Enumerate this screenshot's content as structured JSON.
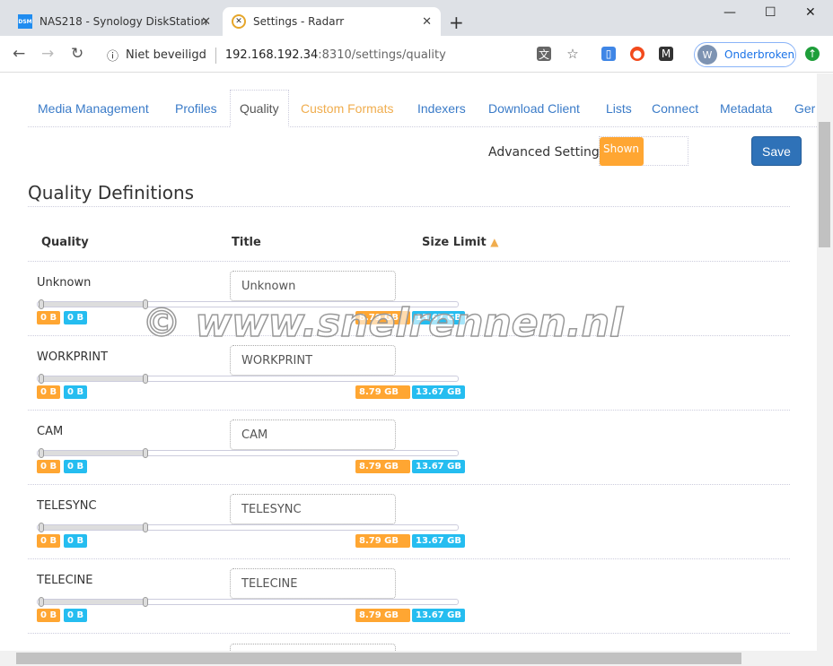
{
  "browser": {
    "tabs": [
      {
        "title": "NAS218 - Synology DiskStation",
        "icon": "dsm-icon"
      },
      {
        "title": "Settings - Radarr",
        "icon": "radarr-icon",
        "active": true
      }
    ],
    "security": "Niet beveiligd",
    "url_host": "192.168.192.34",
    "url_rest": ":8310/settings/quality",
    "profile_initial": "W",
    "profile_label": "Onderbroken",
    "dsm_icon_text": "DSM"
  },
  "settings_tabs": [
    "Media Management",
    "Profiles",
    "Quality",
    "Custom Formats",
    "Indexers",
    "Download Client",
    "Lists",
    "Connect",
    "Metadata",
    "Ger"
  ],
  "active_tab": "Quality",
  "advanced": {
    "label": "Advanced Settings",
    "state": "Shown"
  },
  "save_label": "Save",
  "section_title": "Quality Definitions",
  "columns": {
    "quality": "Quality",
    "title": "Title",
    "size_limit": "Size Limit"
  },
  "rows": [
    {
      "quality": "Unknown",
      "title": "Unknown",
      "min": "0 B",
      "pref": "0 B",
      "max1": "8.79 GB",
      "max2": "13.67 GB"
    },
    {
      "quality": "WORKPRINT",
      "title": "WORKPRINT",
      "min": "0 B",
      "pref": "0 B",
      "max1": "8.79 GB",
      "max2": "13.67 GB"
    },
    {
      "quality": "CAM",
      "title": "CAM",
      "min": "0 B",
      "pref": "0 B",
      "max1": "8.79 GB",
      "max2": "13.67 GB"
    },
    {
      "quality": "TELESYNC",
      "title": "TELESYNC",
      "min": "0 B",
      "pref": "0 B",
      "max1": "8.79 GB",
      "max2": "13.67 GB"
    },
    {
      "quality": "TELECINE",
      "title": "TELECINE",
      "min": "0 B",
      "pref": "0 B",
      "max1": "8.79 GB",
      "max2": "13.67 GB"
    }
  ],
  "watermark": "© www.snelrennen.nl",
  "colors": {
    "accent": "#3a7bc8",
    "orange": "#ffa632",
    "blue": "#25bdf0",
    "save": "#2f72b8"
  }
}
